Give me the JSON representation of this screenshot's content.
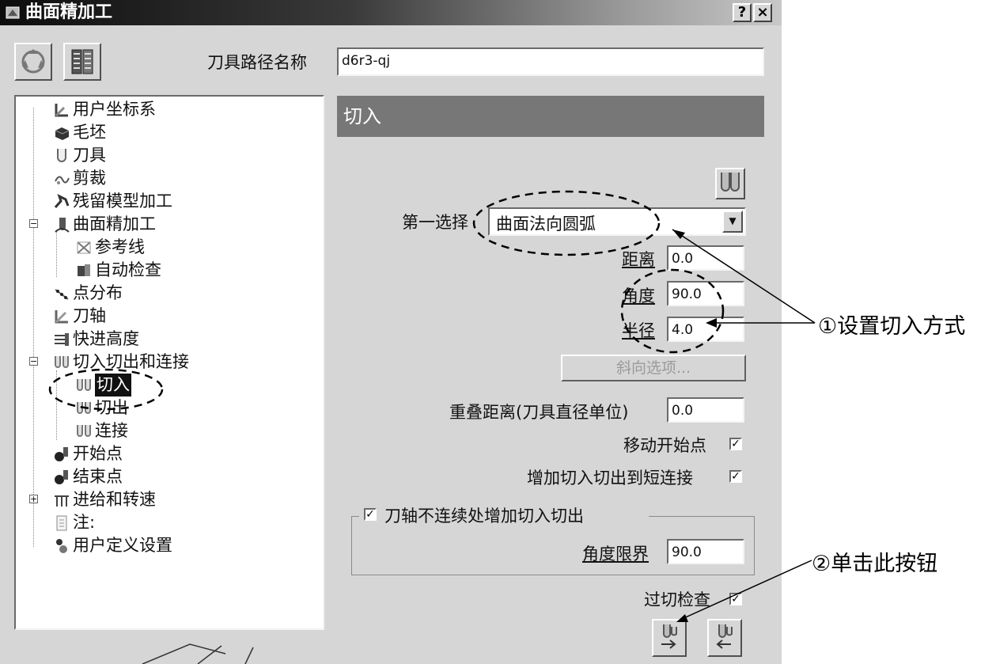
{
  "window": {
    "title": "曲面精加工",
    "help_label": "?",
    "close_label": "×"
  },
  "toolbar": {
    "icon_left": "recycle-icon",
    "icon_right": "toolpath-library-icon"
  },
  "toolpath_name": {
    "label": "刀具路径名称",
    "value": "d6r3-qj"
  },
  "tree": {
    "items": [
      {
        "label": "用户坐标系",
        "icon": "user-coordinate-icon"
      },
      {
        "label": "毛坯",
        "icon": "block-icon"
      },
      {
        "label": "刀具",
        "icon": "tool-icon"
      },
      {
        "label": "剪裁",
        "icon": "trim-icon"
      },
      {
        "label": "残留模型加工",
        "icon": "rest-model-icon"
      },
      {
        "label": "曲面精加工",
        "icon": "surface-finishing-icon"
      },
      {
        "label": "参考线",
        "icon": "reference-line-icon"
      },
      {
        "label": "自动检查",
        "icon": "auto-check-icon"
      },
      {
        "label": "点分布",
        "icon": "point-distribution-icon"
      },
      {
        "label": "刀轴",
        "icon": "tool-axis-icon"
      },
      {
        "label": "快进高度",
        "icon": "rapid-height-icon"
      },
      {
        "label": "切入切出和连接",
        "icon": "leads-links-icon"
      },
      {
        "label": "切入",
        "icon": "lead-in-icon"
      },
      {
        "label": "切出",
        "icon": "lead-out-icon"
      },
      {
        "label": "连接",
        "icon": "links-icon"
      },
      {
        "label": "开始点",
        "icon": "start-point-icon"
      },
      {
        "label": "结束点",
        "icon": "end-point-icon"
      },
      {
        "label": "进给和转速",
        "icon": "feeds-speeds-icon"
      },
      {
        "label": "注:",
        "icon": "notes-icon"
      },
      {
        "label": "用户定义设置",
        "icon": "user-settings-icon"
      }
    ],
    "selected": "切入"
  },
  "panel": {
    "header": "切入",
    "first_choice_label": "第一选择",
    "first_choice_value": "曲面法向圆弧",
    "distance_label": "距离",
    "distance_value": "0.0",
    "angle_label": "角度",
    "angle_value": "90.0",
    "radius_label": "半径",
    "radius_value": "4.0",
    "ramp_options_label": "斜向选项...",
    "overlap_label": "重叠距离(刀具直径单位)",
    "overlap_value": "0.0",
    "move_start_label": "移动开始点",
    "move_start_checked": true,
    "add_leads_short_label": "增加切入切出到短连接",
    "add_leads_short_checked": true,
    "axis_discontinuity_label": "刀轴不连续处增加切入切出",
    "axis_discontinuity_checked": true,
    "angle_limit_label": "角度限界",
    "angle_limit_value": "90.0",
    "gouge_check_label": "过切检查",
    "gouge_check_checked": true,
    "check_mark": "✓"
  },
  "annotations": {
    "first": "①设置切入方式",
    "second": "②单击此按钮"
  }
}
